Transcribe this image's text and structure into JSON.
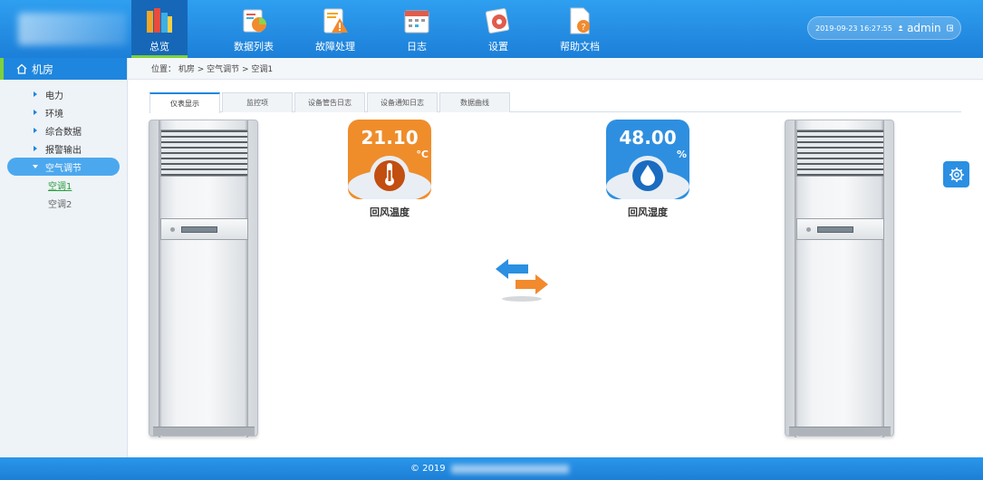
{
  "header": {
    "nav": [
      {
        "label": "总览",
        "icon": "books-icon"
      },
      {
        "label": "数据列表",
        "icon": "data-list-icon"
      },
      {
        "label": "故障处理",
        "icon": "warning-icon"
      },
      {
        "label": "日志",
        "icon": "calendar-icon"
      },
      {
        "label": "设置",
        "icon": "settings-icon"
      },
      {
        "label": "帮助文档",
        "icon": "help-doc-icon"
      }
    ],
    "datetime": "2019-09-23  16:27:55",
    "username": "admin"
  },
  "sidebar": {
    "title": "机房",
    "items": [
      {
        "label": "电力"
      },
      {
        "label": "环境"
      },
      {
        "label": "综合数据"
      },
      {
        "label": "报警输出"
      },
      {
        "label": "空气调节"
      }
    ],
    "subitems": [
      {
        "label": "空调1"
      },
      {
        "label": "空调2"
      }
    ]
  },
  "breadcrumb": "位置：  机房 > 空气调节 > 空调1",
  "tabs": [
    {
      "label": "仪表显示"
    },
    {
      "label": "监控项"
    },
    {
      "label": "设备管告日志"
    },
    {
      "label": "设备通知日志"
    },
    {
      "label": "数据曲线"
    }
  ],
  "sensors": {
    "temperature": {
      "value": "21.10",
      "unit": "°C",
      "label": "回风温度",
      "color": "#ef8d2b"
    },
    "humidity": {
      "value": "48.00",
      "unit": "%",
      "label": "回风湿度",
      "color": "#2e8fe0"
    }
  },
  "footer": {
    "copyright": "© 2019"
  },
  "colors": {
    "header": "#1c7fd8",
    "accent_green": "#7fd13b",
    "active_side": "#4ca8ee"
  }
}
